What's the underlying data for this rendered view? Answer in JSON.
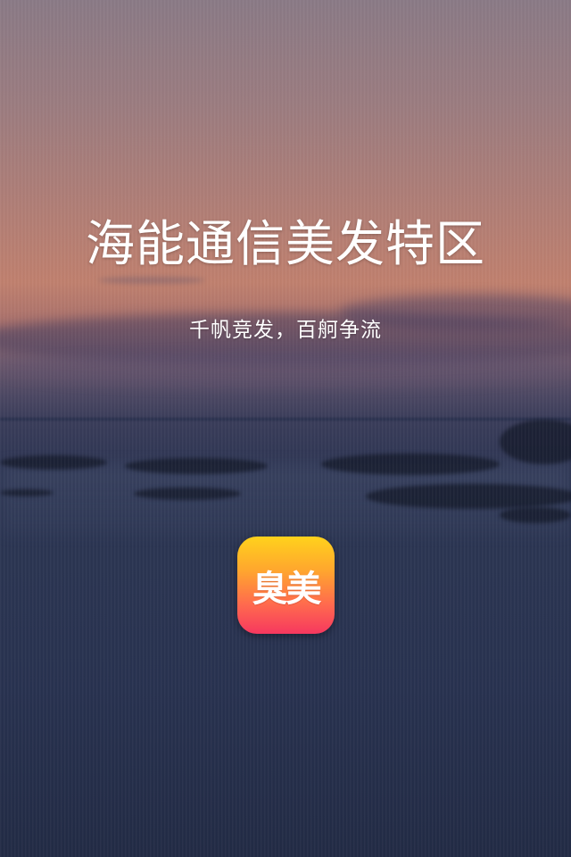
{
  "splash": {
    "title": "海能通信美发特区",
    "slogan": "千帆竞发，百舸争流"
  },
  "app_icon": {
    "label": "臭美",
    "gradient_colors": [
      "#ffd21c",
      "#ffa62e",
      "#ff6a4e",
      "#f6385f"
    ]
  },
  "background": {
    "scene": "sunset-seascape",
    "sky_color": "#c0806e",
    "sea_color": "#283250"
  }
}
